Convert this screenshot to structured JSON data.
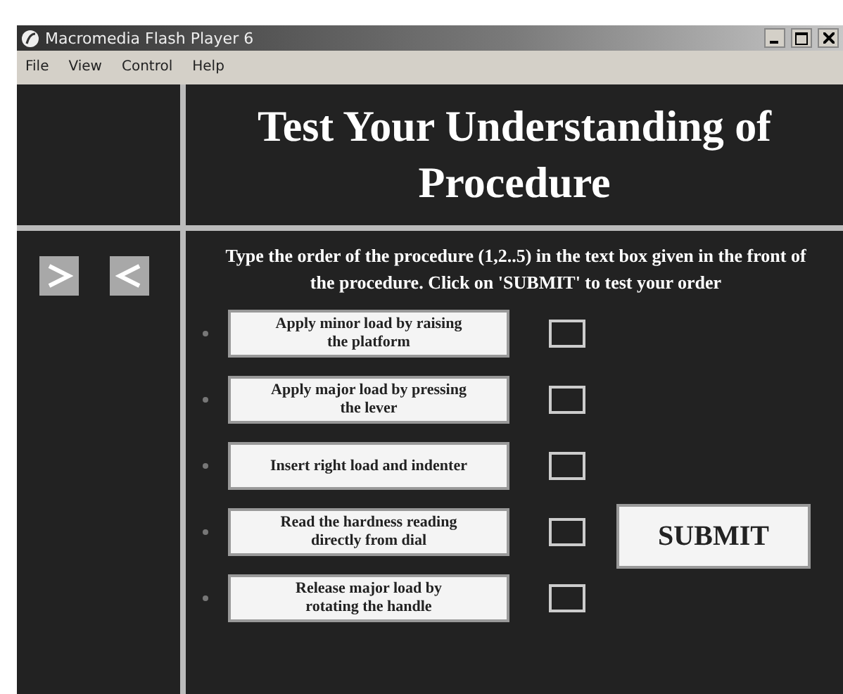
{
  "window": {
    "title": "Macromedia Flash Player 6"
  },
  "menu": [
    "File",
    "View",
    "Control",
    "Help"
  ],
  "heading": "Test Your Understanding of Procedure",
  "instruction": "Type the order of the procedure (1,2..5) in the text box given in the front of the procedure. Click on 'SUBMIT' to test your order",
  "steps": [
    {
      "label": "Apply minor load by raising the platform"
    },
    {
      "label": "Apply major load by pressing the lever"
    },
    {
      "label": "Insert right load and indenter"
    },
    {
      "label": "Read the hardness reading directly from dial"
    },
    {
      "label": "Release major load by rotating the handle"
    }
  ],
  "submit": "SUBMIT"
}
